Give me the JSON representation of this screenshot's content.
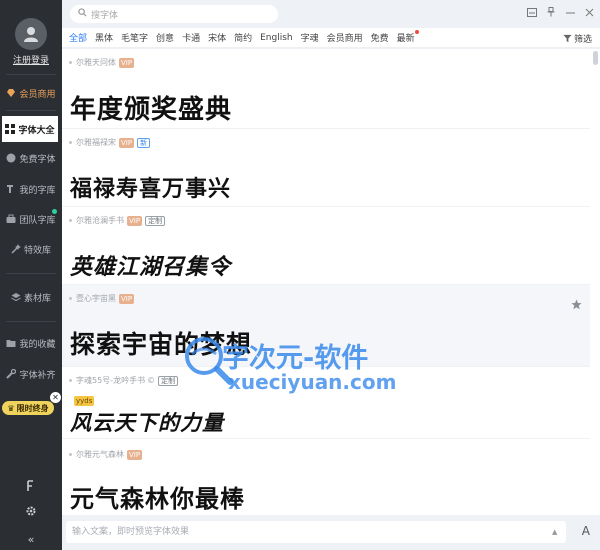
{
  "search": {
    "placeholder": "搜字体"
  },
  "sidebar": {
    "login_label": "注册登录",
    "vip_label": "会员商用",
    "items": [
      {
        "label": "字体大全"
      },
      {
        "label": "免费字体"
      },
      {
        "label": "我的字库"
      },
      {
        "label": "团队字库"
      },
      {
        "label": "特效库"
      },
      {
        "label": "素材库"
      },
      {
        "label": "我的收藏"
      },
      {
        "label": "字体补齐"
      }
    ],
    "promo_label": "限时终身"
  },
  "tabs": [
    "全部",
    "黑体",
    "毛笔字",
    "创意",
    "卡通",
    "宋体",
    "简约",
    "English",
    "字魂",
    "会员商用",
    "免费",
    "最新"
  ],
  "filter_label": "筛选",
  "fonts": [
    {
      "name": "尔雅天问体",
      "badges": [
        "VIP"
      ],
      "sample": "年度颁奖盛典"
    },
    {
      "name": "尔雅福禄宋",
      "badges": [
        "VIP",
        "新"
      ],
      "sample": "福禄寿喜万事兴"
    },
    {
      "name": "尔雅沧澜手书",
      "badges": [
        "VIP",
        "定制"
      ],
      "sample": "英雄江湖召集令"
    },
    {
      "name": "壹心宇宙黑",
      "badges": [
        "VIP"
      ],
      "sample": "探索宇宙的梦想"
    },
    {
      "name": "字魂55号-龙吟手书",
      "badges": [
        "定制",
        "yyds"
      ],
      "sample": "风云天下的力量"
    },
    {
      "name": "尔雅元气森林",
      "badges": [
        "VIP"
      ],
      "sample": "元气森林你最棒"
    }
  ],
  "watermark": {
    "title": "字次元-软件",
    "url": "xueciyuan.com"
  },
  "preview": {
    "placeholder": "输入文案，即时预览字体效果",
    "size_label": "A"
  },
  "colors": {
    "accent": "#2f7cf6",
    "sidebar_bg": "#2b2e33",
    "vip": "#e7b08e"
  }
}
